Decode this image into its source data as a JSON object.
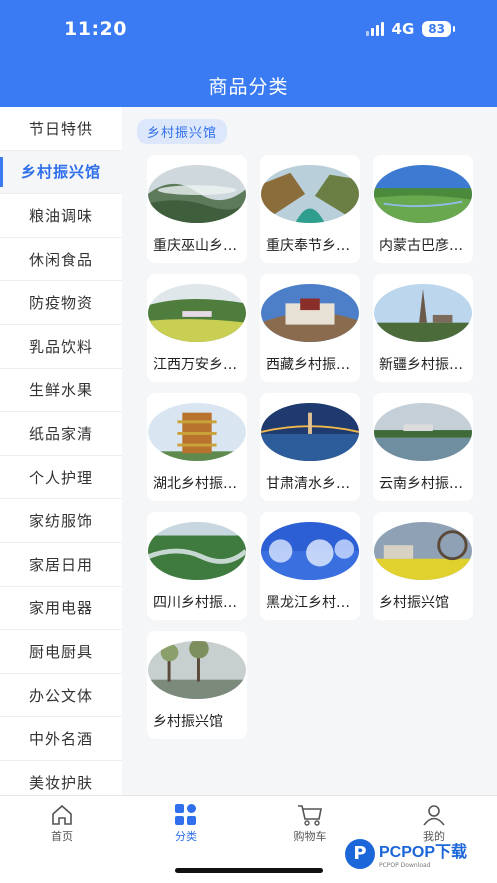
{
  "status": {
    "time": "11:20",
    "network": "4G",
    "battery": "83"
  },
  "header": {
    "title": "商品分类"
  },
  "sidebar": {
    "items": [
      {
        "label": "节日特供",
        "active": false
      },
      {
        "label": "乡村振兴馆",
        "active": true
      },
      {
        "label": "粮油调味",
        "active": false
      },
      {
        "label": "休闲食品",
        "active": false
      },
      {
        "label": "防疫物资",
        "active": false
      },
      {
        "label": "乳品饮料",
        "active": false
      },
      {
        "label": "生鲜水果",
        "active": false
      },
      {
        "label": "纸品家清",
        "active": false
      },
      {
        "label": "个人护理",
        "active": false
      },
      {
        "label": "家纺服饰",
        "active": false
      },
      {
        "label": "家居日用",
        "active": false
      },
      {
        "label": "家用电器",
        "active": false
      },
      {
        "label": "厨电厨具",
        "active": false
      },
      {
        "label": "办公文体",
        "active": false
      },
      {
        "label": "中外名酒",
        "active": false
      },
      {
        "label": "美妆护肤",
        "active": false
      }
    ]
  },
  "content": {
    "category_tag": "乡村振兴馆",
    "items": [
      {
        "title": "重庆巫山乡村振兴馆",
        "scene": "mountain-fog"
      },
      {
        "title": "重庆奉节乡村振兴馆",
        "scene": "river-gorge"
      },
      {
        "title": "内蒙古巴彦淖尔乡村振兴馆",
        "scene": "grassland"
      },
      {
        "title": "江西万安乡村振兴馆",
        "scene": "town-field"
      },
      {
        "title": "西藏乡村振兴馆",
        "scene": "palace"
      },
      {
        "title": "新疆乡村振兴馆",
        "scene": "pagoda"
      },
      {
        "title": "湖北乡村振兴馆",
        "scene": "tower"
      },
      {
        "title": "甘肃清水乡村振兴馆",
        "scene": "bridge-night"
      },
      {
        "title": "云南乡村振兴馆",
        "scene": "lake"
      },
      {
        "title": "四川乡村振兴馆",
        "scene": "river-bend"
      },
      {
        "title": "黑龙江乡村振兴馆",
        "scene": "frost"
      },
      {
        "title": "乡村振兴馆",
        "scene": "waterwheel"
      },
      {
        "title": "乡村振兴馆",
        "scene": "trees-pond"
      }
    ]
  },
  "tabbar": {
    "tabs": [
      {
        "label": "首页",
        "icon": "home-icon",
        "active": false
      },
      {
        "label": "分类",
        "icon": "category-icon",
        "active": true
      },
      {
        "label": "购物车",
        "icon": "cart-icon",
        "active": false
      },
      {
        "label": "我的",
        "icon": "user-icon",
        "active": false
      }
    ]
  },
  "watermark": {
    "brand": "PCPOP下载",
    "sub": "PCPOP Download"
  },
  "colors": {
    "primary": "#3a7bf3",
    "active_text": "#2f6fec",
    "background": "#f5f6f8"
  }
}
